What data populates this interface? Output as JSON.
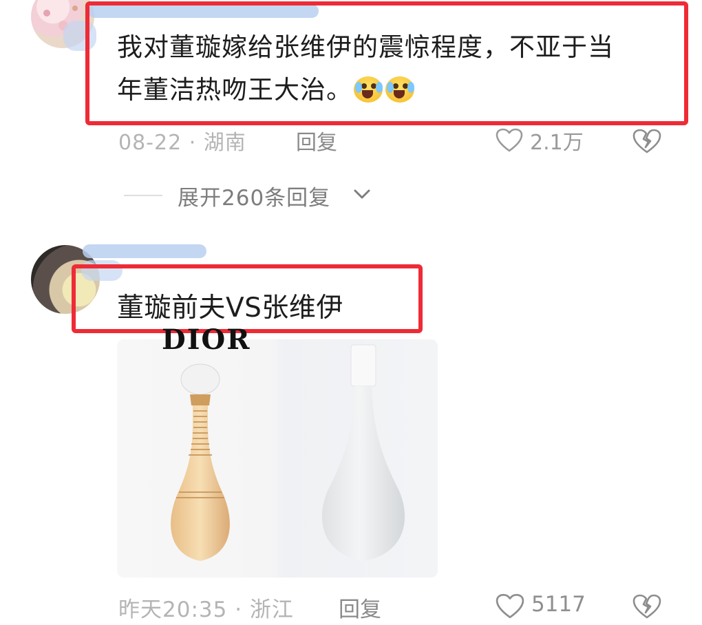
{
  "comment1": {
    "text_line1": "我对董璇嫁给张维伊的震惊程度，不亚于当",
    "text_line2": "年董洁热吻王大治。",
    "emoji_icons": [
      "crying-face-icon",
      "crying-face-icon"
    ],
    "date_location": "08-22 · 湖南",
    "reply_label": "回复",
    "likes": "2.1万"
  },
  "expand": {
    "label": "展开260条回复"
  },
  "comment2": {
    "text": "董璇前夫VS张维伊",
    "image_text": "DIOR",
    "date_location": "昨天20:35 · 浙江",
    "reply_label": "回复",
    "likes": "5117"
  },
  "colors": {
    "highlight_box": "#ee2b36",
    "meta_text": "#b4b4b4"
  }
}
